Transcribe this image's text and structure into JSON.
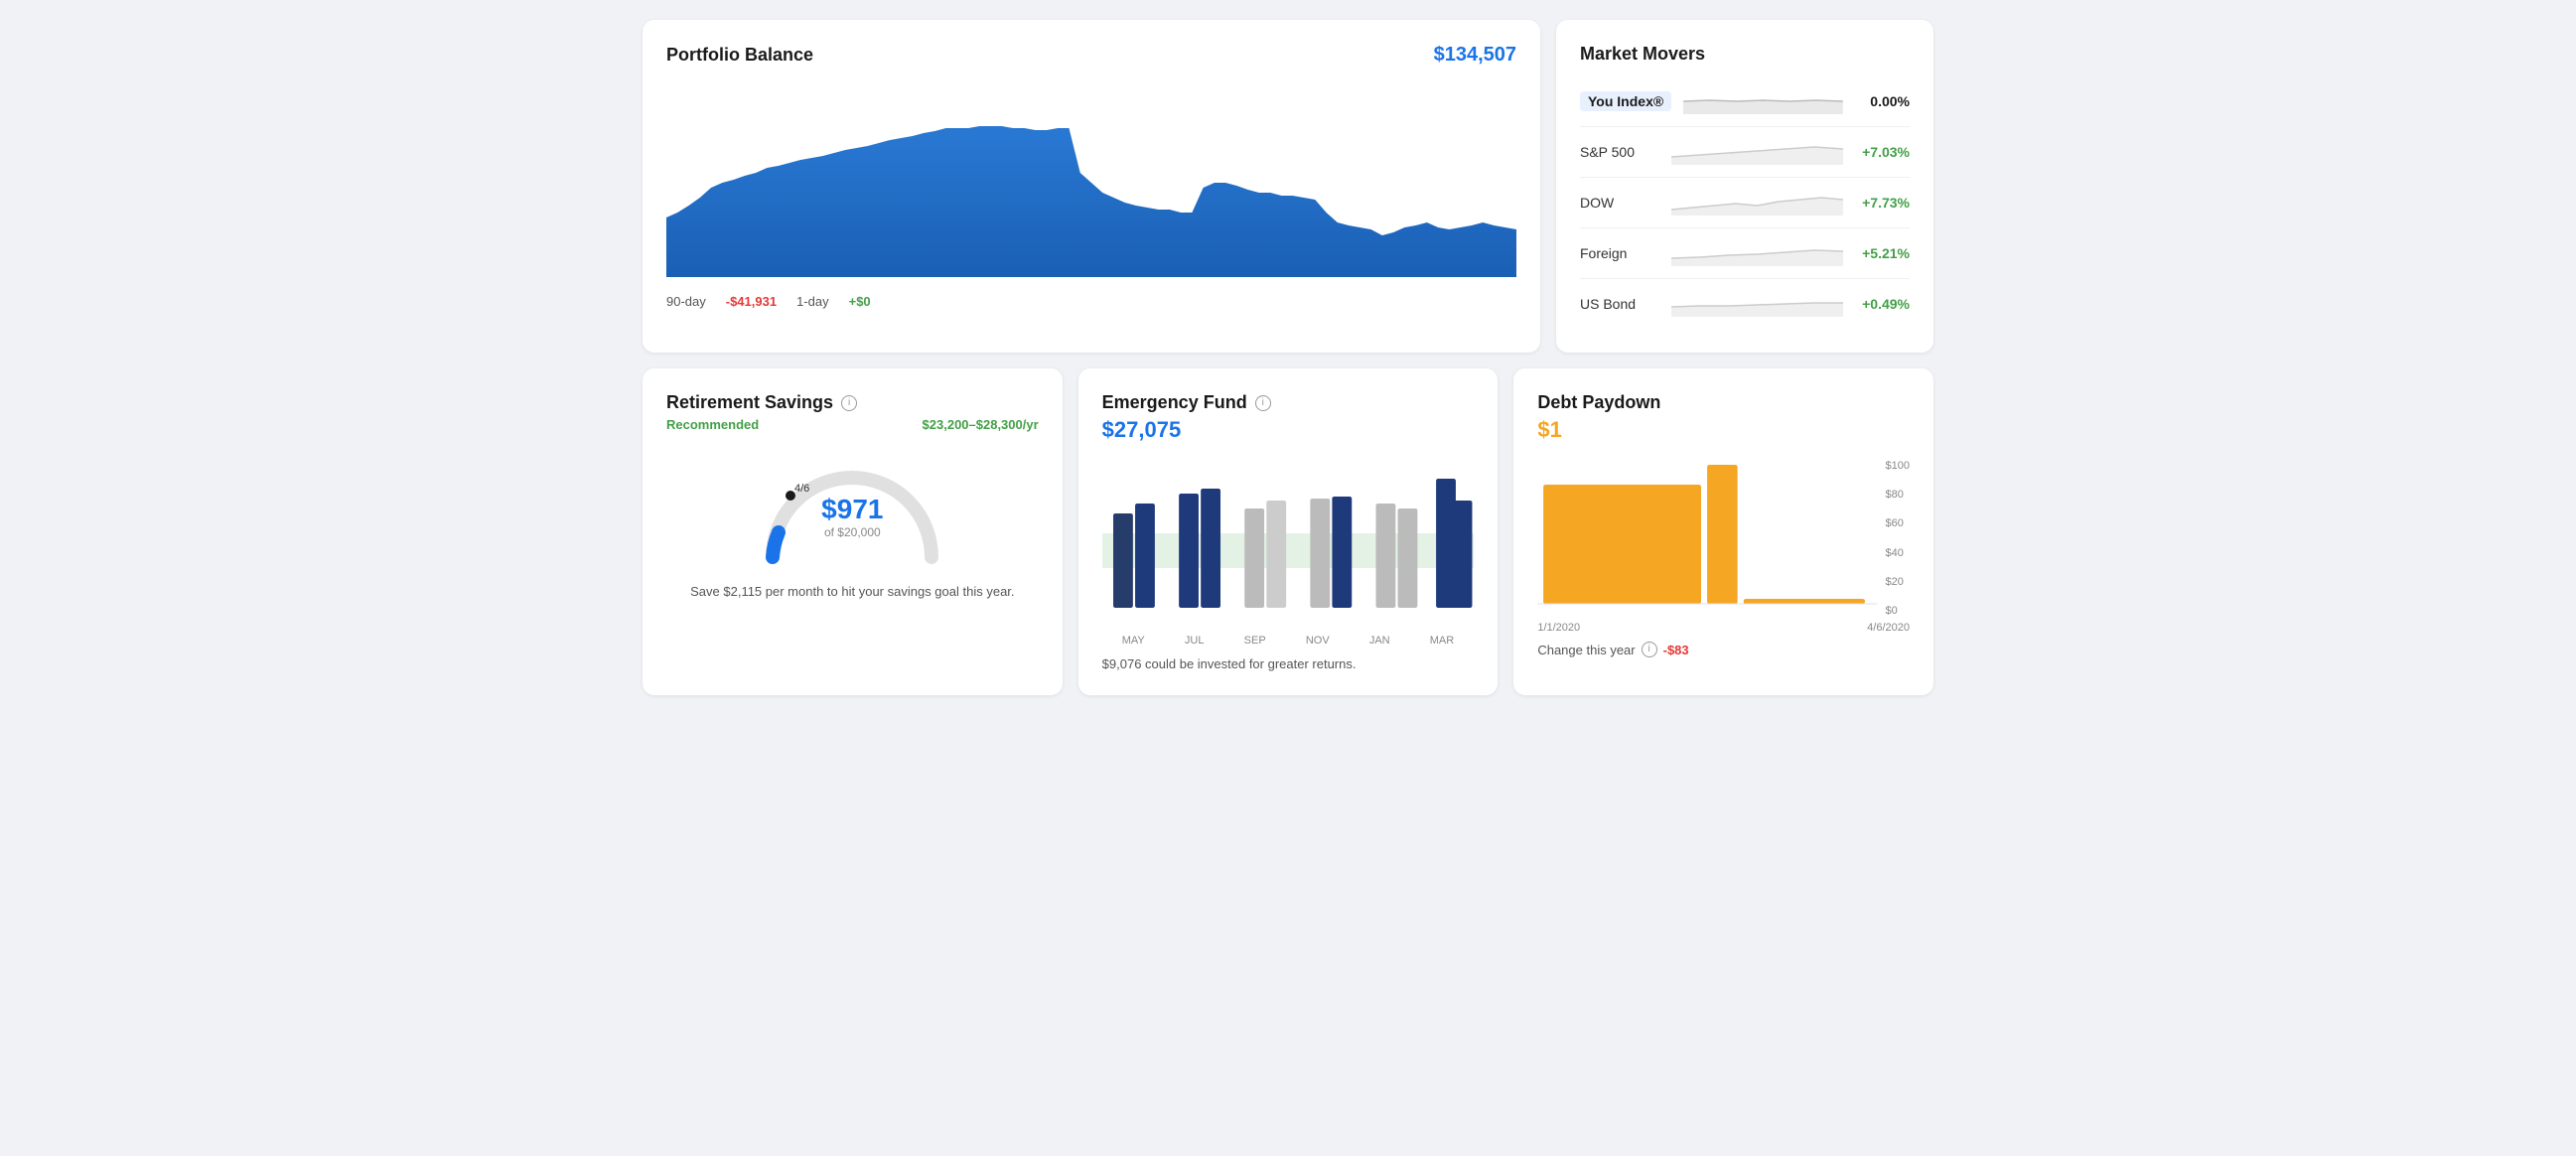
{
  "portfolio": {
    "title": "Portfolio Balance",
    "balance": "$134,507",
    "stat_90day_label": "90-day",
    "stat_90day_value": "-$41,931",
    "stat_1day_label": "1-day",
    "stat_1day_value": "+$0"
  },
  "market_movers": {
    "title": "Market Movers",
    "items": [
      {
        "name": "You Index®",
        "change": "0.00%",
        "change_class": "change-neutral",
        "you_index": true
      },
      {
        "name": "S&P 500",
        "change": "+7.03%",
        "change_class": "change-positive",
        "you_index": false
      },
      {
        "name": "DOW",
        "change": "+7.73%",
        "change_class": "change-positive",
        "you_index": false
      },
      {
        "name": "Foreign",
        "change": "+5.21%",
        "change_class": "change-positive",
        "you_index": false
      },
      {
        "name": "US Bond",
        "change": "+0.49%",
        "change_class": "change-positive",
        "you_index": false
      }
    ]
  },
  "retirement": {
    "title": "Retirement Savings",
    "recommended_label": "Recommended",
    "recommended_range": "$23,200–$28,300/yr",
    "gauge_amount": "$971",
    "gauge_of": "of $20,000",
    "gauge_marker": "4/6",
    "note": "Save $2,115 per month to hit your savings goal this year."
  },
  "emergency": {
    "title": "Emergency Fund",
    "amount": "$27,075",
    "note": "$9,076 could be invested for greater returns.",
    "months": [
      "MAY",
      "JUL",
      "SEP",
      "NOV",
      "JAN",
      "MAR"
    ]
  },
  "debt": {
    "title": "Debt Paydown",
    "amount": "$1",
    "date_start": "1/1/2020",
    "date_end": "4/6/2020",
    "change_label": "Change this year",
    "change_value": "-$83",
    "y_labels": [
      "$100",
      "$80",
      "$60",
      "$40",
      "$20",
      "$0"
    ]
  }
}
